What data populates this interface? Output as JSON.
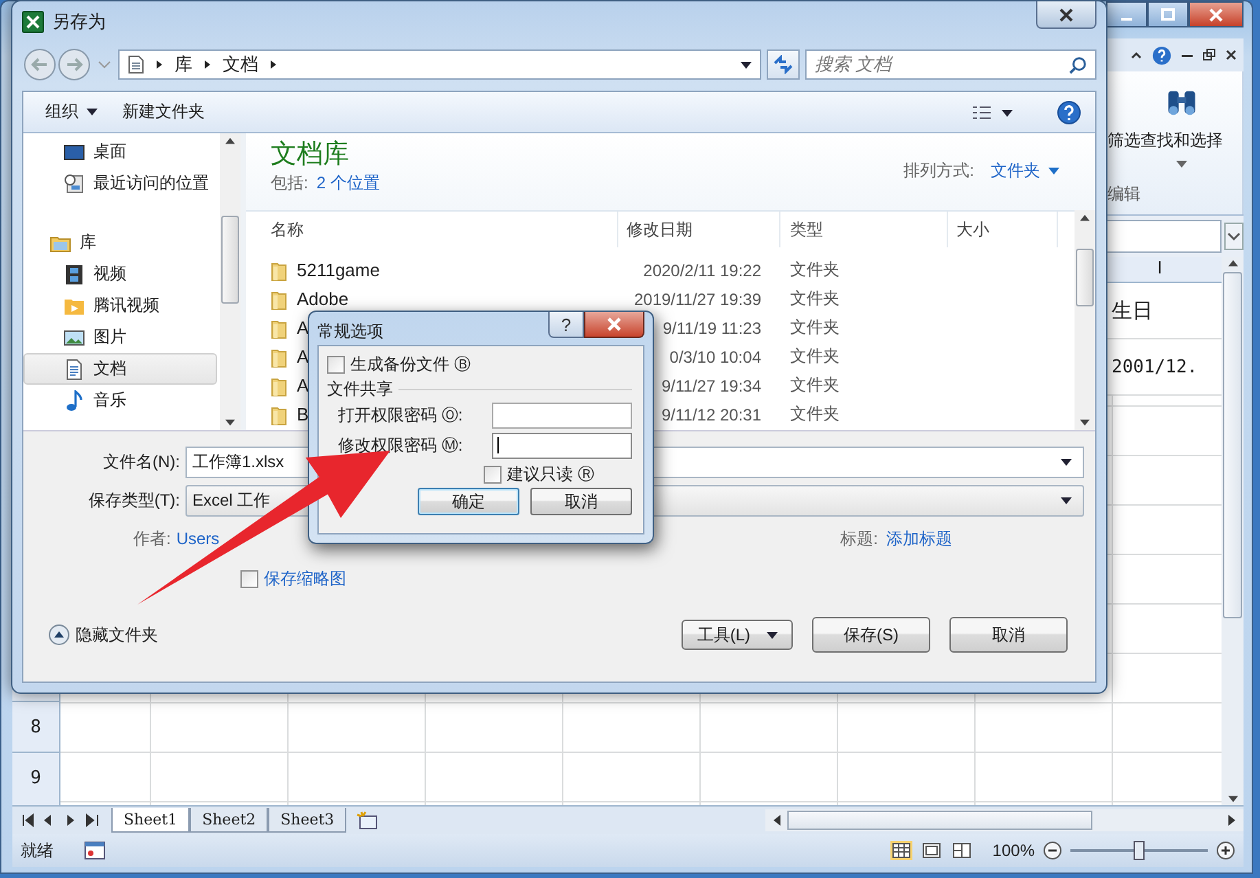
{
  "excel": {
    "ribbon": {
      "sort_label": "筛选",
      "find_label": "查找和选择",
      "group_label": "编辑"
    },
    "column_header": "I",
    "cells": [
      "生日",
      "2001/12."
    ],
    "row_numbers": [
      "8",
      "9"
    ],
    "sheet_tabs": [
      {
        "label": "Sheet1",
        "selected": true
      },
      {
        "label": "Sheet2",
        "selected": false
      },
      {
        "label": "Sheet3",
        "selected": false
      }
    ],
    "status": "就绪",
    "zoom": {
      "reading": "100%",
      "level": 0.5
    }
  },
  "save_dialog": {
    "title": "另存为",
    "breadcrumb": [
      "库",
      "文档"
    ],
    "search": {
      "placeholder": "搜索 文档"
    },
    "toolbar": {
      "organize": "组织",
      "new_folder": "新建文件夹"
    },
    "nav": [
      {
        "label": "桌面",
        "kind": "desktop",
        "selected": false
      },
      {
        "label": "最近访问的位置",
        "kind": "recent",
        "selected": false
      },
      {
        "label": "库",
        "kind": "library",
        "selected": false,
        "children": [
          {
            "label": "视频",
            "kind": "video",
            "selected": false
          },
          {
            "label": "腾讯视频",
            "kind": "folder_video",
            "selected": false
          },
          {
            "label": "图片",
            "kind": "pictures",
            "selected": false
          },
          {
            "label": "文档",
            "kind": "documents",
            "selected": true
          },
          {
            "label": "音乐",
            "kind": "music",
            "selected": false
          }
        ]
      }
    ],
    "library": {
      "title": "文档库",
      "includes_label": "包括:",
      "includes_link": "2 个位置",
      "arrange_label": "排列方式:",
      "arrange_value": "文件夹"
    },
    "columns": [
      "名称",
      "修改日期",
      "类型",
      "大小"
    ],
    "rows": [
      {
        "name": "5211game",
        "date": "2020/2/11 19:22",
        "type": "文件夹"
      },
      {
        "name": "Adobe",
        "date": "2019/11/27 19:39",
        "type": "文件夹"
      },
      {
        "name": "A",
        "date": "9/11/19 11:23",
        "type": "文件夹"
      },
      {
        "name": "A",
        "date": "0/3/10 10:04",
        "type": "文件夹"
      },
      {
        "name": "A",
        "date": "9/11/27 19:34",
        "type": "文件夹"
      },
      {
        "name": "B",
        "date": "9/11/12 20:31",
        "type": "文件夹"
      }
    ],
    "file_name": {
      "label": "文件名(N):",
      "value": "工作簿1.xlsx"
    },
    "save_type": {
      "label": "保存类型(T):",
      "value": "Excel 工作"
    },
    "author": {
      "label": "作者:",
      "value": "Users"
    },
    "title_field": {
      "label": "标题:",
      "value": "添加标题"
    },
    "thumbnail": {
      "label": "保存缩略图",
      "checked": false
    },
    "hide_folders": "隐藏文件夹",
    "buttons": {
      "tools": "工具(L)",
      "save": "保存(S)",
      "cancel": "取消"
    }
  },
  "options_dialog": {
    "title": "常规选项",
    "help": "?",
    "backup": {
      "label": "生成备份文件 Ⓑ",
      "checked": false
    },
    "group": "文件共享",
    "fields": [
      {
        "label": "打开权限密码 Ⓞ:",
        "focused": false
      },
      {
        "label": "修改权限密码 Ⓜ:",
        "focused": true
      }
    ],
    "read_only": {
      "label": "建议只读 Ⓡ",
      "checked": false
    },
    "buttons": {
      "ok": "确定",
      "cancel": "取消"
    }
  }
}
